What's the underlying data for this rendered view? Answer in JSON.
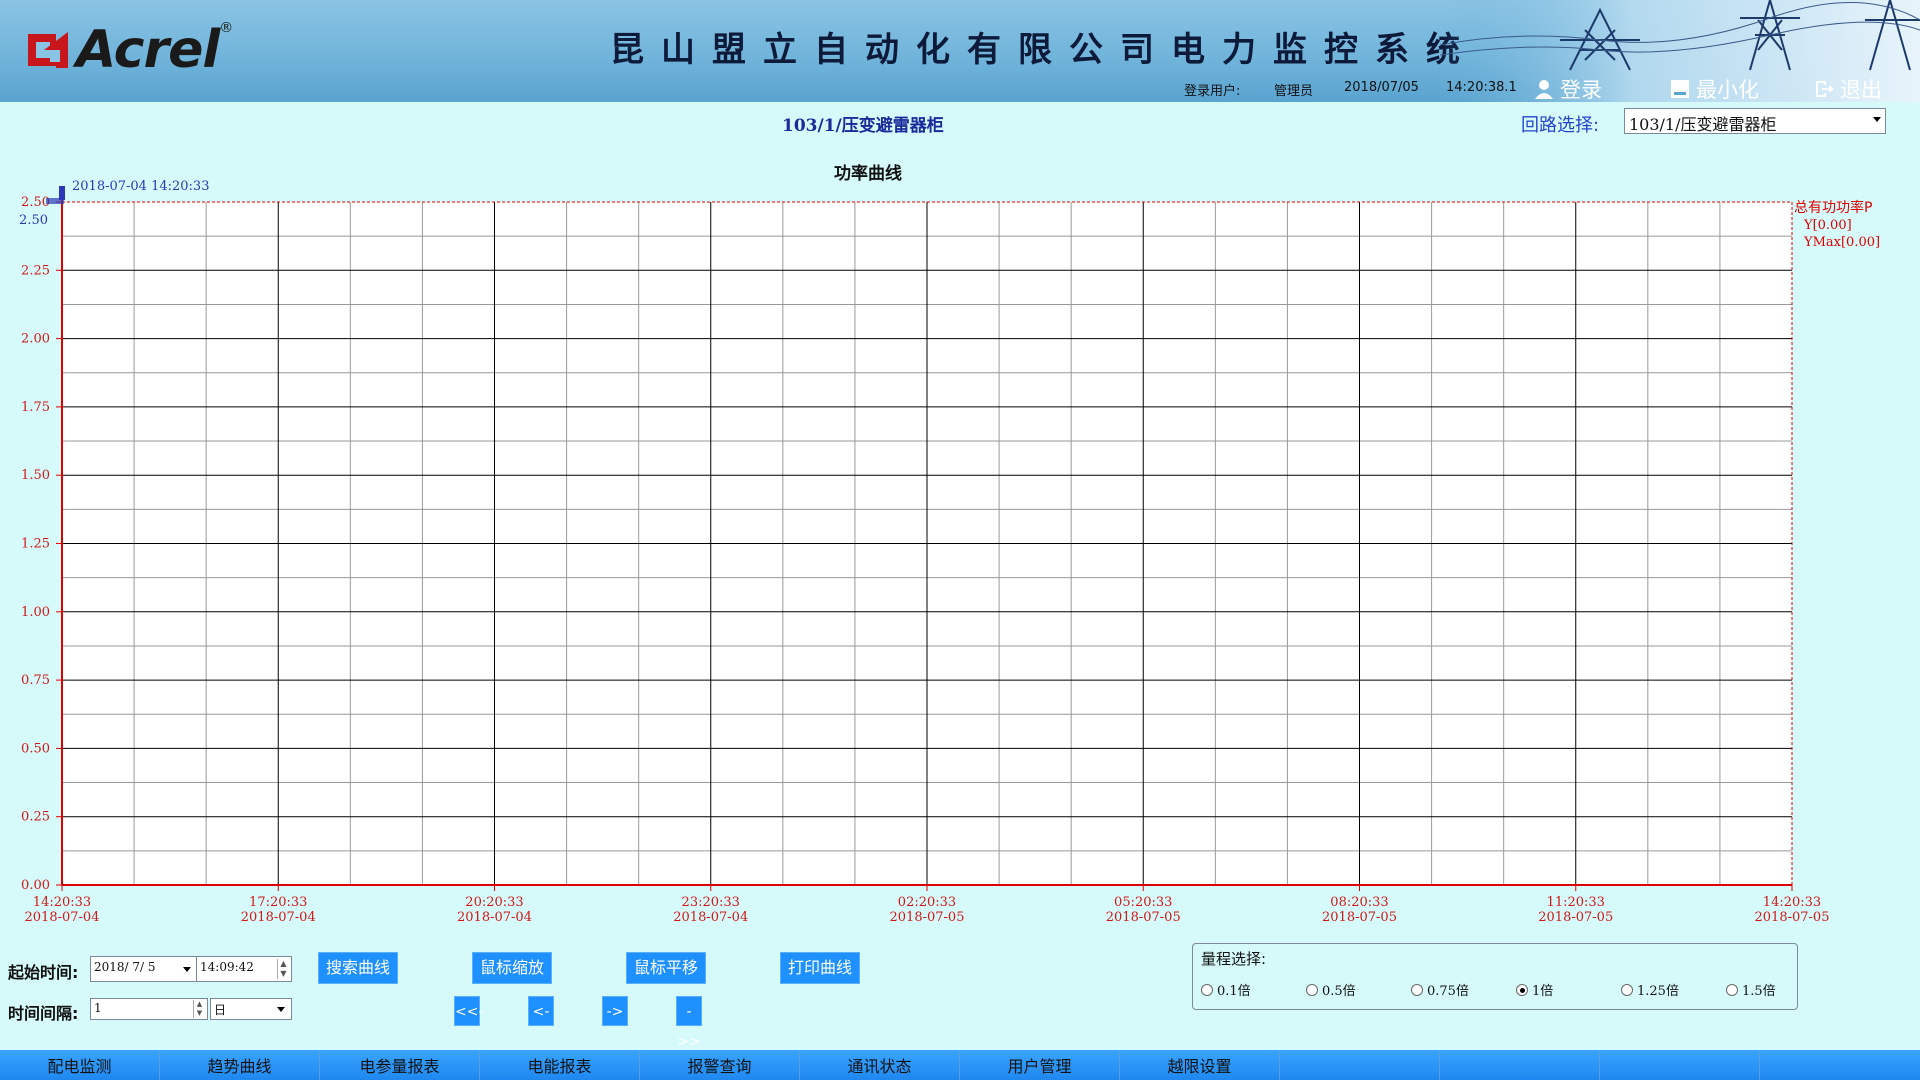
{
  "header": {
    "logo_text": "Acrel",
    "logo_reg": "®",
    "system_title": "昆山盟立自动化有限公司电力监控系统",
    "user_label": "登录用户:",
    "user_name": "管理员",
    "date": "2018/07/05",
    "time": "14:20:38.1",
    "login_label": "登录",
    "minimize_label": "最小化",
    "exit_label": "退出"
  },
  "loop": {
    "title": "103/1/压变避雷器柜",
    "select_label": "回路选择:",
    "select_value": "103/1/压变避雷器柜"
  },
  "chart_data": {
    "type": "line",
    "title": "功率曲线",
    "cursor_label": "2018-07-04 14:20:33",
    "y_ticks": [
      "2.50",
      "2.25",
      "2.00",
      "1.75",
      "1.50",
      "1.25",
      "1.00",
      "0.75",
      "0.50",
      "0.25",
      "0.00"
    ],
    "y_top_label": "2.50",
    "ylim": [
      0,
      2.5
    ],
    "x_ticks": [
      {
        "time": "14:20:33",
        "date": "2018-07-04"
      },
      {
        "time": "17:20:33",
        "date": "2018-07-04"
      },
      {
        "time": "20:20:33",
        "date": "2018-07-04"
      },
      {
        "time": "23:20:33",
        "date": "2018-07-04"
      },
      {
        "time": "02:20:33",
        "date": "2018-07-05"
      },
      {
        "time": "05:20:33",
        "date": "2018-07-05"
      },
      {
        "time": "08:20:33",
        "date": "2018-07-05"
      },
      {
        "time": "11:20:33",
        "date": "2018-07-05"
      },
      {
        "time": "14:20:33",
        "date": "2018-07-05"
      }
    ],
    "legend": [
      {
        "text": "总有功功率P"
      },
      {
        "text": "Y[0.00]"
      },
      {
        "text": "YMax[0.00]"
      }
    ],
    "series": [
      {
        "values": []
      }
    ],
    "grid": true,
    "colors": {
      "axis": "#e00000",
      "major_grid": "#000000",
      "minor_grid": "#999999",
      "label": "#d01818",
      "cursor": "#2b38b8"
    }
  },
  "controls": {
    "start_label": "起始时间:",
    "start_date": "2018/ 7/ 5",
    "start_time": "14:09:42",
    "interval_label": "时间间隔:",
    "interval_value": "1",
    "interval_unit": "日",
    "search_btn": "搜索曲线",
    "zoom_btn": "鼠标缩放",
    "pan_btn": "鼠标平移",
    "print_btn": "打印曲线",
    "nav": [
      "<<-",
      "<-",
      "->",
      "->>"
    ]
  },
  "range": {
    "title": "量程选择:",
    "options": [
      "0.1倍",
      "0.5倍",
      "0.75倍",
      "1倍",
      "1.25倍",
      "1.5倍"
    ],
    "selected": 3
  },
  "tabs": [
    "配电监测",
    "趋势曲线",
    "电参量报表",
    "电能报表",
    "报警查询",
    "通讯状态",
    "用户管理",
    "越限设置",
    "",
    "",
    "",
    ""
  ]
}
